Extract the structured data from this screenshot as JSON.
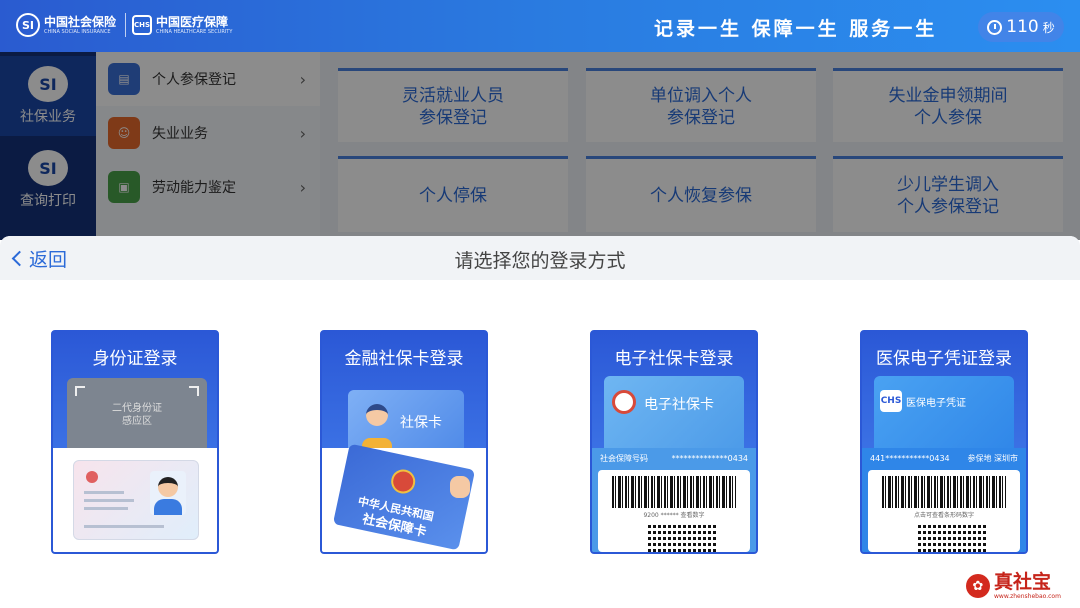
{
  "header": {
    "logo1_cn": "中国社会保险",
    "logo1_en": "CHINA SOCIAL INSURANCE",
    "logo1_mark": "SI",
    "logo2_cn": "中国医疗保障",
    "logo2_en": "CHINA HEALTHCARE SECURITY",
    "logo2_mark": "CHS",
    "slogan": "记录一生 保障一生 服务一生",
    "timer_value": "110",
    "timer_unit": "秒"
  },
  "left_nav": {
    "items": [
      {
        "label": "社保业务",
        "icon": "SI"
      },
      {
        "label": "查询打印",
        "icon": "SI"
      }
    ]
  },
  "submenu": {
    "items": [
      {
        "label": "个人参保登记",
        "icon": "doc-icon"
      },
      {
        "label": "失业业务",
        "icon": "person-icon"
      },
      {
        "label": "劳动能力鉴定",
        "icon": "card-icon"
      }
    ]
  },
  "tiles": [
    "灵活就业人员\n参保登记",
    "单位调入个人\n参保登记",
    "失业金申领期间\n个人参保",
    "个人停保",
    "个人恢复参保",
    "少儿学生调入\n个人参保登记"
  ],
  "modal": {
    "back_label": "返回",
    "title": "请选择您的登录方式"
  },
  "login_options": {
    "id_card": {
      "title": "身份证登录",
      "reader_text": "二代身份证\n感应区"
    },
    "bank_card": {
      "title": "金融社保卡登录",
      "card_label": "社保卡",
      "card_text_1": "中华人民共和国",
      "card_text_2": "社会保障卡"
    },
    "e_card": {
      "title": "电子社保卡登录",
      "card_label": "电子社保卡",
      "bar_left": "社会保障号码",
      "bar_right": "**************0434",
      "barcode_num": "9200 ****** 查看数字"
    },
    "med_card": {
      "title": "医保电子凭证登录",
      "card_label": "医保电子凭证",
      "logo": "CHS",
      "bar_left": "441***********0434",
      "bar_right": "参保地 深圳市",
      "barcode_num": "点击可查看条形码数字"
    }
  },
  "watermark": {
    "cn": "真社宝",
    "en": "www.zhenshebao.com"
  },
  "colors": {
    "header_start": "#2a5bd0",
    "header_end": "#2b8ef0",
    "accent": "#2b6ad8",
    "card_blue": "#2b58d6",
    "watermark_red": "#c6241a"
  }
}
